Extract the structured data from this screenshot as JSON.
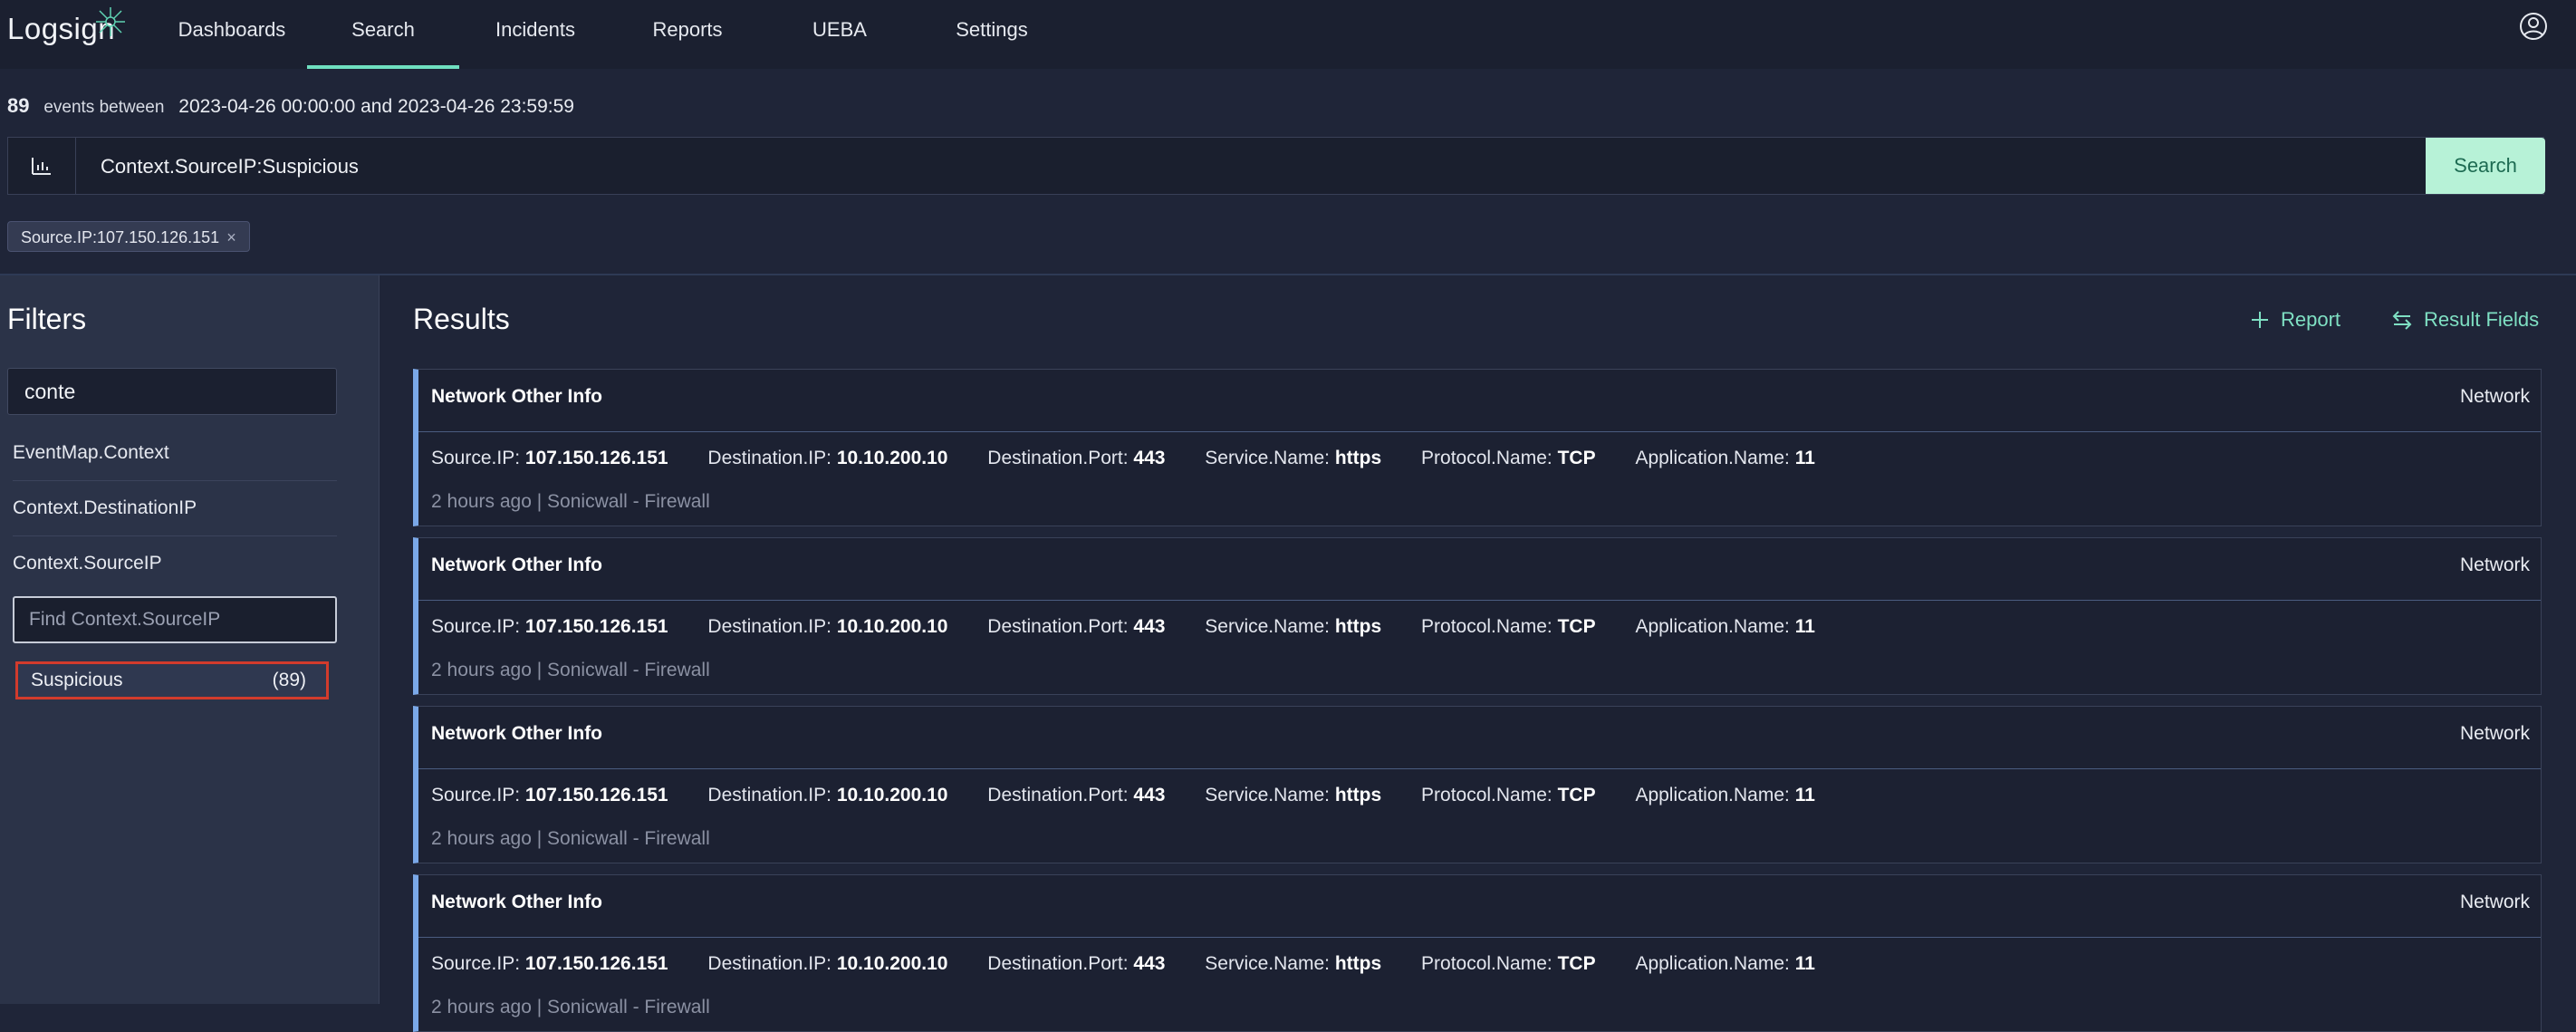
{
  "app": {
    "logo_text": "Logsign"
  },
  "nav": {
    "items": [
      "Dashboards",
      "Search",
      "Incidents",
      "Reports",
      "UEBA",
      "Settings"
    ],
    "active": "Search"
  },
  "summary": {
    "count": "89",
    "label": "events between",
    "range": "2023-04-26 00:00:00 and 2023-04-26 23:59:59"
  },
  "query": {
    "value": "Context.SourceIP:Suspicious"
  },
  "search_button": "Search",
  "active_filter_chip": {
    "label": "Source.IP:107.150.126.151",
    "remove": "×"
  },
  "filters": {
    "title": "Filters",
    "search_value": "conte",
    "fields": [
      "EventMap.Context",
      "Context.DestinationIP",
      "Context.SourceIP"
    ],
    "find_placeholder": "Find Context.SourceIP",
    "values": [
      {
        "label": "Suspicious",
        "count": "(89)"
      }
    ]
  },
  "results": {
    "title": "Results",
    "report_label": "Report",
    "result_fields_label": "Result Fields",
    "cards": [
      {
        "title": "Network Other Info",
        "category": "Network",
        "fields": [
          {
            "key": "Source.IP:",
            "value": "107.150.126.151"
          },
          {
            "key": "Destination.IP:",
            "value": "10.10.200.10"
          },
          {
            "key": "Destination.Port:",
            "value": "443"
          },
          {
            "key": "Service.Name:",
            "value": "https"
          },
          {
            "key": "Protocol.Name:",
            "value": "TCP"
          },
          {
            "key": "Application.Name:",
            "value": "11"
          }
        ],
        "meta": "2 hours ago | Sonicwall - Firewall"
      },
      {
        "title": "Network Other Info",
        "category": "Network",
        "fields": [
          {
            "key": "Source.IP:",
            "value": "107.150.126.151"
          },
          {
            "key": "Destination.IP:",
            "value": "10.10.200.10"
          },
          {
            "key": "Destination.Port:",
            "value": "443"
          },
          {
            "key": "Service.Name:",
            "value": "https"
          },
          {
            "key": "Protocol.Name:",
            "value": "TCP"
          },
          {
            "key": "Application.Name:",
            "value": "11"
          }
        ],
        "meta": "2 hours ago | Sonicwall - Firewall"
      },
      {
        "title": "Network Other Info",
        "category": "Network",
        "fields": [
          {
            "key": "Source.IP:",
            "value": "107.150.126.151"
          },
          {
            "key": "Destination.IP:",
            "value": "10.10.200.10"
          },
          {
            "key": "Destination.Port:",
            "value": "443"
          },
          {
            "key": "Service.Name:",
            "value": "https"
          },
          {
            "key": "Protocol.Name:",
            "value": "TCP"
          },
          {
            "key": "Application.Name:",
            "value": "11"
          }
        ],
        "meta": "2 hours ago | Sonicwall - Firewall"
      },
      {
        "title": "Network Other Info",
        "category": "Network",
        "fields": [
          {
            "key": "Source.IP:",
            "value": "107.150.126.151"
          },
          {
            "key": "Destination.IP:",
            "value": "10.10.200.10"
          },
          {
            "key": "Destination.Port:",
            "value": "443"
          },
          {
            "key": "Service.Name:",
            "value": "https"
          },
          {
            "key": "Protocol.Name:",
            "value": "TCP"
          },
          {
            "key": "Application.Name:",
            "value": "11"
          }
        ],
        "meta": "2 hours ago | Sonicwall - Firewall"
      }
    ]
  },
  "colors": {
    "accent": "#6fe0c0",
    "search_button_bg": "#b7f2d7",
    "card_border": "#7aa8e8",
    "highlight_border": "#d23b2c"
  }
}
